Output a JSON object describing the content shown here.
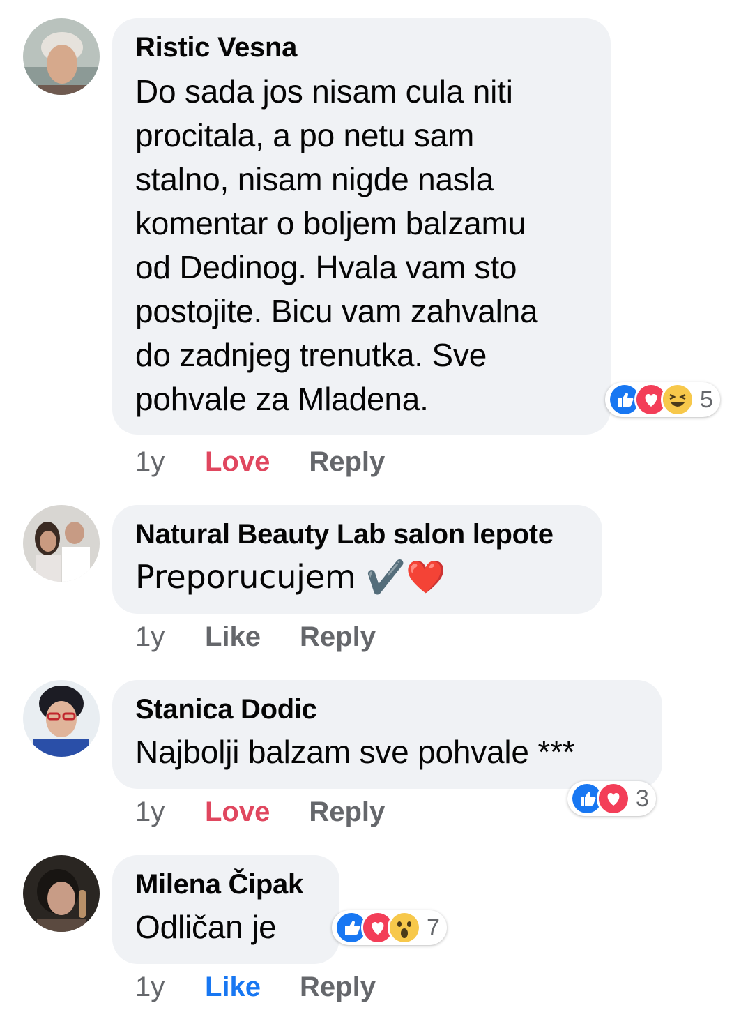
{
  "comments": [
    {
      "author": "Ristic Vesna",
      "text": "Do sada jos nisam cula niti\nprocitala, a po netu sam\nstalno, nisam nigde nasla\nkomentar o boljem balzamu\nod Dedinog. Hvala vam sto\npostojite. Bicu vam zahvalna\ndo zadnjeg trenutka. Sve\npohvale za Mladena.",
      "age": "1y",
      "action": "Love",
      "reply": "Reply",
      "reactions": {
        "icons": [
          "like-icon",
          "love-icon",
          "haha-icon"
        ],
        "count": "5"
      }
    },
    {
      "author": "Natural Beauty Lab salon lepote",
      "text": "Preporucujem ✔️❤️",
      "age": "1y",
      "action": "Like",
      "reply": "Reply"
    },
    {
      "author": "Stanica Dodic",
      "text": "Najbolji balzam sve pohvale ***",
      "age": "1y",
      "action": "Love",
      "reply": "Reply",
      "reactions": {
        "icons": [
          "like-icon",
          "love-icon"
        ],
        "count": "3"
      }
    },
    {
      "author": "Milena Čipak",
      "text": "Odličan je",
      "age": "1y",
      "action": "Like",
      "reply": "Reply",
      "reactions": {
        "icons": [
          "like-icon",
          "love-icon",
          "wow-icon"
        ],
        "count": "7"
      }
    }
  ],
  "colors": {
    "bubble": "#f0f2f5",
    "meta": "#65676b",
    "love": "#e0475f",
    "like_active": "#1877f2",
    "like_icon": "#1877f2",
    "love_icon": "#f33e58",
    "emoji_yellow": "#f7c84b"
  }
}
